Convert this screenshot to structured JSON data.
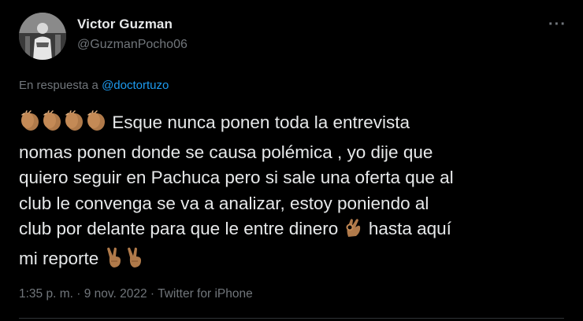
{
  "user": {
    "name": "Victor Guzman",
    "handle": "@GuzmanPocho06"
  },
  "more_icon": "more-horizontal-icon",
  "reply": {
    "prefix": "En respuesta a ",
    "mention": "@doctortuzo"
  },
  "body": {
    "line1": "Esque nunca ponen toda la entrevista",
    "line2": "nomas ponen donde se causa polémica , yo dije que",
    "line3": "quiero seguir en Pachuca pero si sale una oferta que al",
    "line4": "club le convenga se va a analizar, estoy poniendo al",
    "line5a": "club por delante para que le entre dinero",
    "line5b": "hasta aquí",
    "line6": "mi reporte"
  },
  "emojis": {
    "clap": "clapping-hands-icon",
    "ok": "ok-hand-icon",
    "victory": "victory-hand-icon"
  },
  "meta": {
    "time": "1:35 p. m.",
    "sep": " · ",
    "date": "9 nov. 2022",
    "source": "Twitter for iPhone"
  },
  "colors": {
    "background": "#000000",
    "text": "#e7e9ea",
    "secondary": "#71767b",
    "link": "#1d9bf0",
    "emoji_skin": "#b07a4a"
  }
}
